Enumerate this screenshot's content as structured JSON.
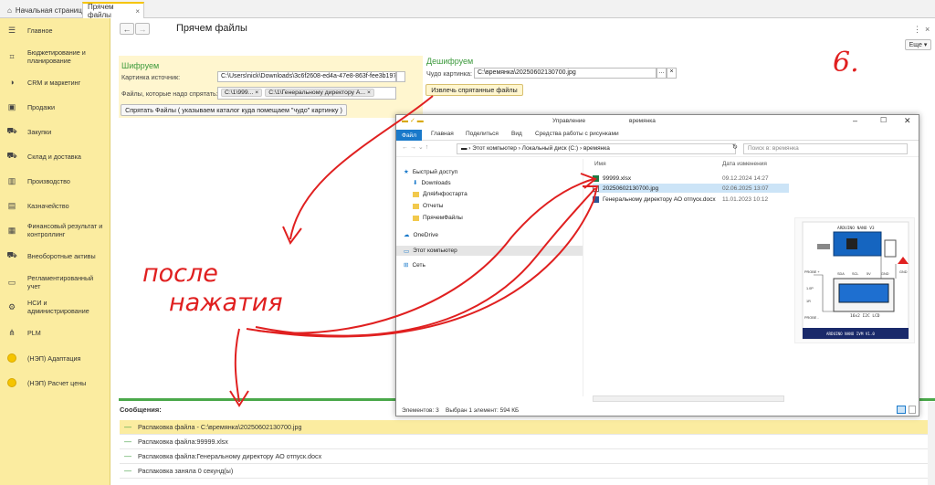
{
  "topbar": {
    "home_tab": "Начальная страница",
    "active_tab": "Прячем файлы"
  },
  "sidebar": {
    "items": [
      {
        "icon": "menu-icon",
        "label": "Главное"
      },
      {
        "icon": "chart-icon",
        "label": "Бюджетирование и планирование"
      },
      {
        "icon": "crm-icon",
        "label": "CRM и маркетинг"
      },
      {
        "icon": "sales-icon",
        "label": "Продажи"
      },
      {
        "icon": "cart-icon",
        "label": "Закупки"
      },
      {
        "icon": "truck-icon",
        "label": "Склад и доставка"
      },
      {
        "icon": "factory-icon",
        "label": "Производство"
      },
      {
        "icon": "bank-icon",
        "label": "Казначейство"
      },
      {
        "icon": "finance-icon",
        "label": "Финансовый результат и контроллинг"
      },
      {
        "icon": "assets-icon",
        "label": "Внеоборотные активы"
      },
      {
        "icon": "document-icon",
        "label": "Регламентированный учет"
      },
      {
        "icon": "gear-icon",
        "label": "НСИ и администрирование"
      },
      {
        "icon": "org-icon",
        "label": "PLM"
      },
      {
        "icon": "coin-icon",
        "label": "(НЭП) Адаптация"
      },
      {
        "icon": "coin-icon",
        "label": "(НЭП) Расчет цены"
      }
    ]
  },
  "form": {
    "title": "Прячем файлы",
    "more": "Еще",
    "encode_title": "Шифруем",
    "source_label": "Картинка источник:",
    "source_value": "C:\\Users\\nick\\Downloads\\3c6f2608-ed4a-47e8-863f-fee3b197a8",
    "files_label": "Файлы, которые надо спрятать:",
    "tags": [
      "C:\\1\\999...",
      "C:\\1\\Генеральному директору А..."
    ],
    "hide_button": "Спрятать Файлы ( указываем каталог куда помещаем \"чудо\" картинку )",
    "decode_title": "Дешифруем",
    "miracle_label": "Чудо картинка:",
    "miracle_value": "C:\\времянка\\20250602130700.jpg",
    "extract_button": "Извлечь спрятанные файлы"
  },
  "messages": {
    "title": "Сообщения:",
    "rows": [
      "Распаковка файла - C:\\времянка\\20250602130700.jpg",
      "Распаковка файла:99999.xlsx",
      "Распаковка файла:Генеральному директору АО отпуск.docx",
      "Распаковка заняла 0 секунд(ы)"
    ]
  },
  "explorer": {
    "window_title": "времянка",
    "ribbon_group": "Управление",
    "tabs": [
      "Файл",
      "Главная",
      "Поделиться",
      "Вид",
      "Средства работы с рисунками"
    ],
    "address": [
      "Этот компьютер",
      "Локальный диск (C:)",
      "времянка"
    ],
    "search_placeholder": "Поиск в: времянка",
    "nav": [
      "Быстрый доступ",
      "Downloads",
      "ДляИнфостарта",
      "Отчеты",
      "ПрячемФайлы",
      "OneDrive",
      "Этот компьютер",
      "Сеть"
    ],
    "col_name": "Имя",
    "col_date": "Дата изменения",
    "files": [
      {
        "name": "99999.xlsx",
        "date": "09.12.2024 14:27",
        "selected": false
      },
      {
        "name": "20250602130700.jpg",
        "date": "02.06.2025 13:07",
        "selected": true
      },
      {
        "name": "Генеральному директору АО отпуск.docx",
        "date": "11.01.2023 10:12",
        "selected": false
      }
    ],
    "status_count": "Элементов: 3",
    "status_selected": "Выбран 1 элемент: 594 КБ"
  },
  "preview": {
    "board_title": "ARDUINO NANO V3",
    "lcd_label": "16x2 I2C LCD",
    "footer": "ARDUINO NANO IVM V1.0",
    "pins": [
      "SDA",
      "SCL",
      "5V",
      "GND"
    ],
    "side_labels": [
      "PROBE +",
      "PROBE -",
      "1.0P",
      "1R",
      "GND"
    ]
  },
  "annotation": {
    "mark": "6.",
    "text_line1": "после",
    "text_line2": "нажатия",
    "color": "#e02020"
  }
}
